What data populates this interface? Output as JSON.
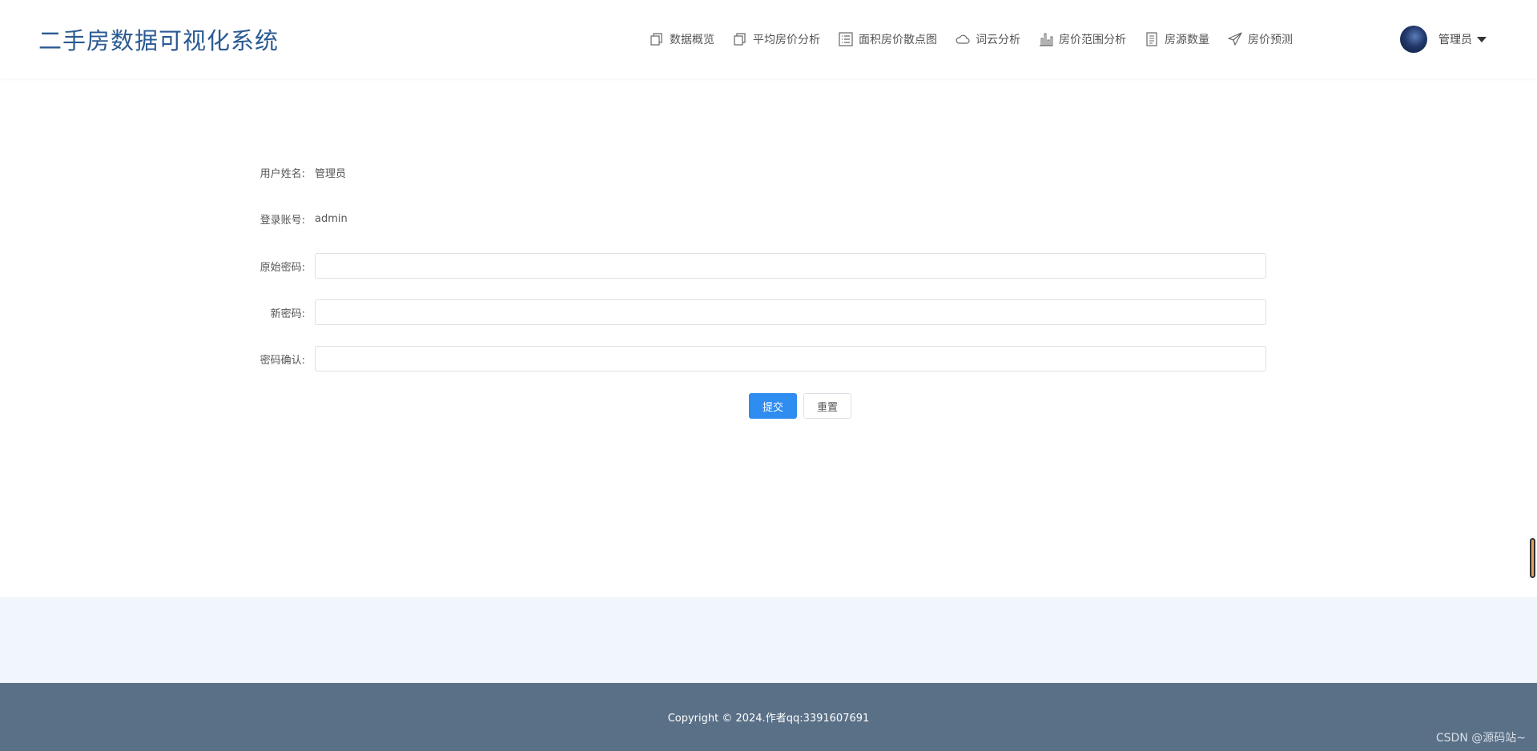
{
  "header": {
    "brand": "二手房数据可视化系统",
    "nav": [
      {
        "label": "数据概览",
        "icon": "copy-icon"
      },
      {
        "label": "平均房价分析",
        "icon": "copy-icon"
      },
      {
        "label": "面积房价散点图",
        "icon": "list-icon"
      },
      {
        "label": "词云分析",
        "icon": "cloud-icon"
      },
      {
        "label": "房价范围分析",
        "icon": "bar-chart-icon"
      },
      {
        "label": "房源数量",
        "icon": "document-icon"
      },
      {
        "label": "房价预测",
        "icon": "send-icon"
      }
    ],
    "user": {
      "name": "管理员",
      "avatar": "user-avatar"
    }
  },
  "form": {
    "username_label": "用户姓名:",
    "username_value": "管理员",
    "account_label": "登录账号:",
    "account_value": "admin",
    "old_password_label": "原始密码:",
    "old_password_value": "",
    "new_password_label": "新密码:",
    "new_password_value": "",
    "confirm_label": "密码确认:",
    "confirm_value": "",
    "submit_label": "提交",
    "reset_label": "重置"
  },
  "footer": {
    "copyright": "Copyright © 2024.作者qq:3391607691",
    "watermark": "CSDN @源码站~"
  },
  "colors": {
    "brand": "#2a5a92",
    "primary": "#2f8cf0",
    "footer_bg": "#5a7087",
    "band_bg": "#f1f5fc"
  }
}
